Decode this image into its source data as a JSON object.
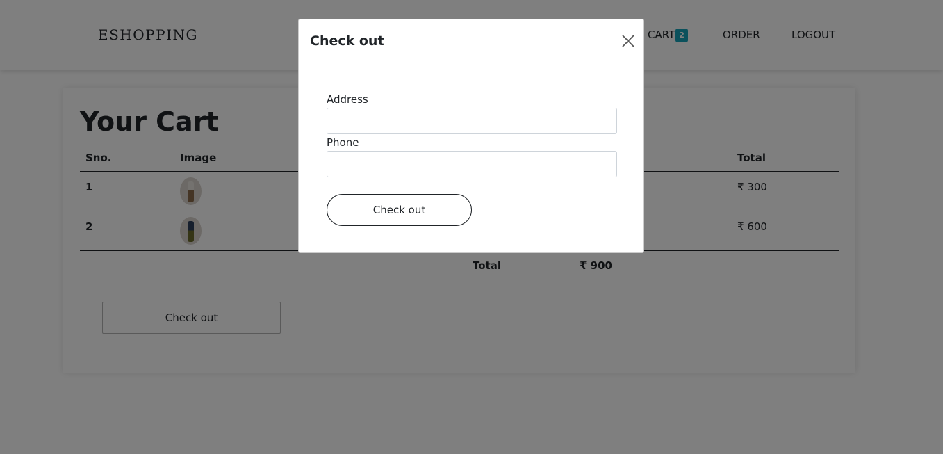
{
  "navbar": {
    "brand": "ESHOPPING",
    "items": [
      {
        "label": "CART",
        "badge": "2"
      },
      {
        "label": "ORDER"
      },
      {
        "label": "LOGOUT"
      }
    ]
  },
  "cart": {
    "title": "Your Cart",
    "columns": [
      "Sno.",
      "Image",
      "Total"
    ],
    "rows": [
      {
        "sno": "1",
        "image": "product-thumbnail",
        "total": "₹ 300"
      },
      {
        "sno": "2",
        "image": "product-thumbnail",
        "total": "₹ 600"
      }
    ],
    "summary_label": "Total",
    "summary_value": "₹ 900",
    "checkout_label": "Check out"
  },
  "modal": {
    "title": "Check out",
    "close_icon": "close-icon",
    "address_label": "Address",
    "address_value": "",
    "phone_label": "Phone",
    "phone_value": "",
    "submit_label": "Check out"
  },
  "colors": {
    "badge": "#17a2b8",
    "overlay": "rgba(0,0,0,0.5)",
    "text": "#212529"
  }
}
